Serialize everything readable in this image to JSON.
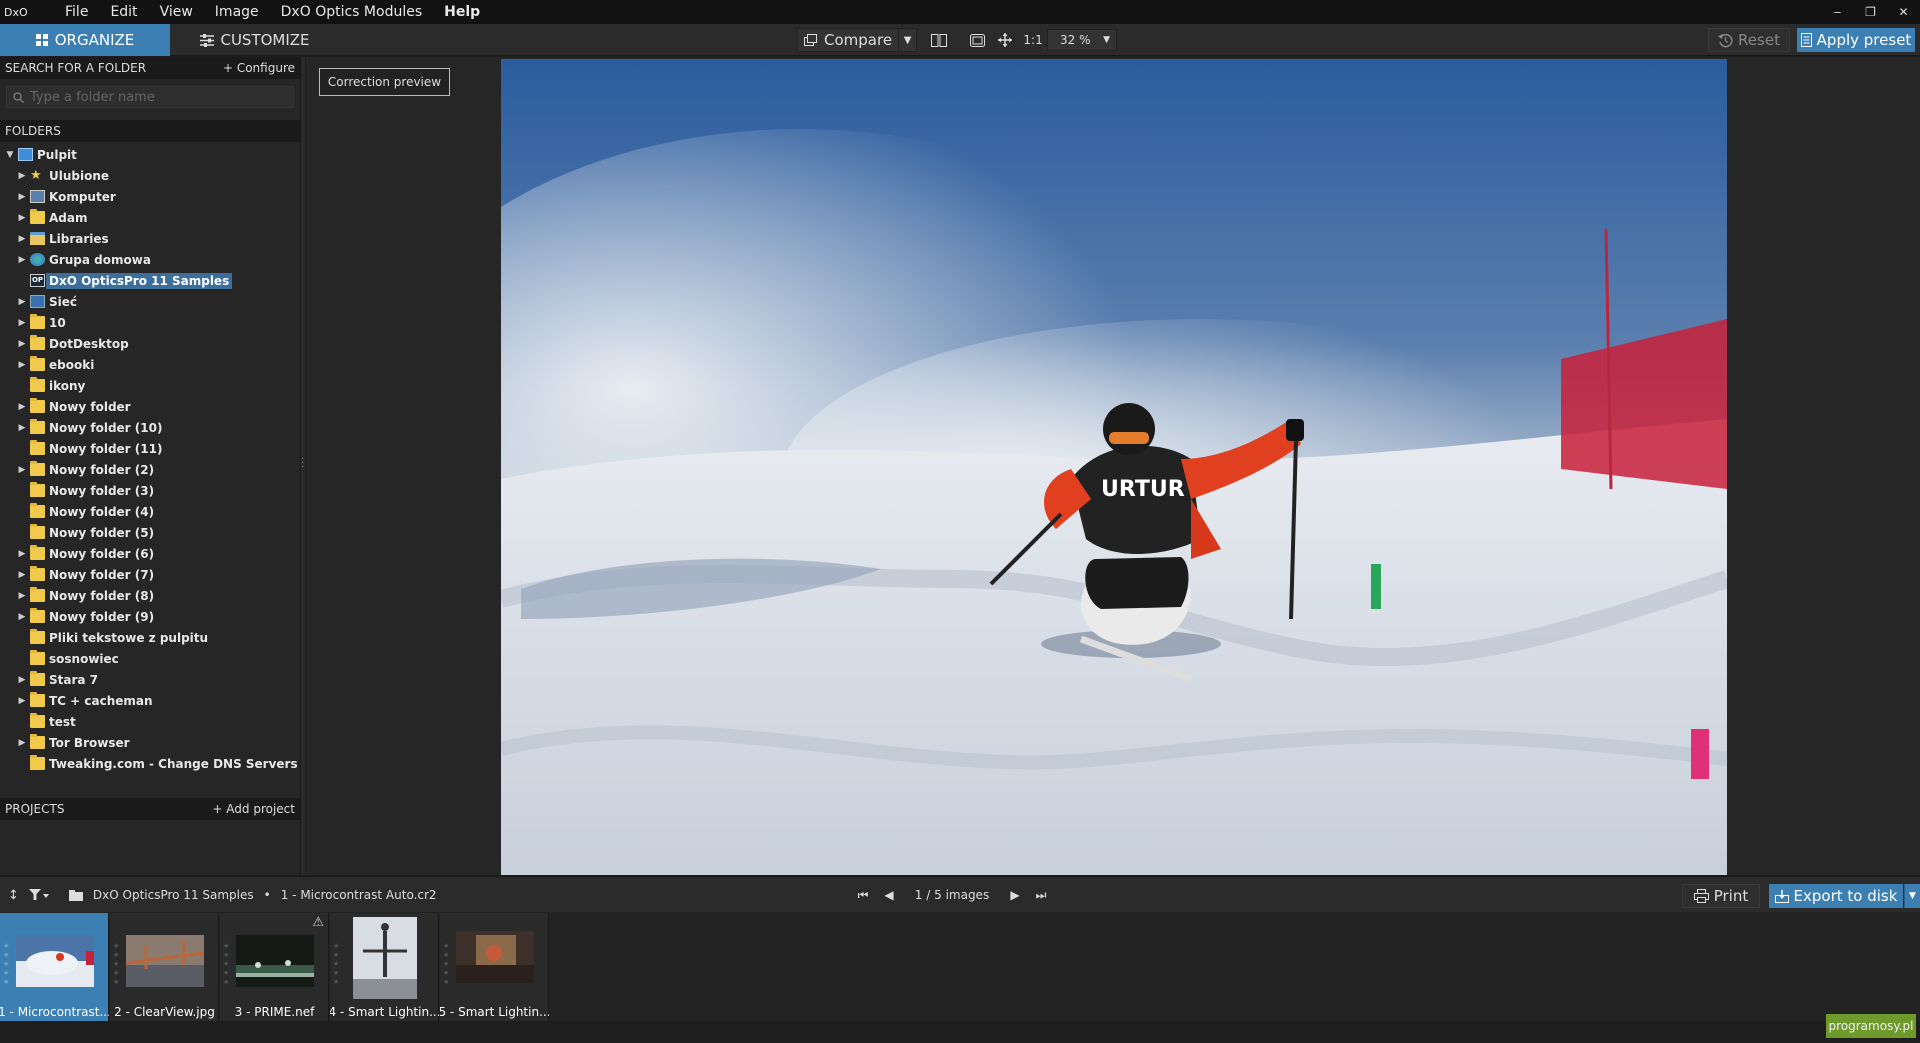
{
  "app": {
    "logo_text": "DxO",
    "menu": [
      "File",
      "Edit",
      "View",
      "Image",
      "DxO Optics Modules",
      "Help"
    ]
  },
  "window_controls": {
    "minimize": "‒",
    "restore": "❐",
    "close": "✕"
  },
  "toolbar": {
    "tab_organize": "ORGANIZE",
    "tab_customize": "CUSTOMIZE",
    "compare_label": "Compare",
    "one_to_one": "1:1",
    "zoom_value": "32 %",
    "reset_label": "Reset",
    "apply_preset_label": "Apply preset"
  },
  "search_section": {
    "header": "SEARCH FOR A FOLDER",
    "configure": "+ Configure",
    "placeholder": "Type a folder name"
  },
  "folders_section": {
    "header": "FOLDERS",
    "items": [
      {
        "label": "Pulpit",
        "level": 0,
        "expanded": true,
        "icon": "desktop-icon"
      },
      {
        "label": "Ulubione",
        "level": 1,
        "arrow": true,
        "icon": "star-icon"
      },
      {
        "label": "Komputer",
        "level": 1,
        "arrow": true,
        "icon": "computer-icon"
      },
      {
        "label": "Adam",
        "level": 1,
        "arrow": true,
        "icon": "folder-icon"
      },
      {
        "label": "Libraries",
        "level": 1,
        "arrow": true,
        "icon": "libraries-icon"
      },
      {
        "label": "Grupa domowa",
        "level": 1,
        "arrow": true,
        "icon": "homegroup-icon"
      },
      {
        "label": "DxO OpticsPro 11 Samples",
        "level": 1,
        "arrow": false,
        "icon": "dxo-icon",
        "selected": true
      },
      {
        "label": "Sieć",
        "level": 1,
        "arrow": true,
        "icon": "network-icon"
      },
      {
        "label": "10",
        "level": 1,
        "arrow": true,
        "icon": "folder-icon"
      },
      {
        "label": "DotDesktop",
        "level": 1,
        "arrow": true,
        "icon": "folder-icon"
      },
      {
        "label": "ebooki",
        "level": 1,
        "arrow": true,
        "icon": "folder-icon"
      },
      {
        "label": "ikony",
        "level": 1,
        "arrow": false,
        "icon": "folder-icon"
      },
      {
        "label": "Nowy folder",
        "level": 1,
        "arrow": true,
        "icon": "folder-icon"
      },
      {
        "label": "Nowy folder (10)",
        "level": 1,
        "arrow": true,
        "icon": "folder-icon"
      },
      {
        "label": "Nowy folder (11)",
        "level": 1,
        "arrow": false,
        "icon": "folder-icon"
      },
      {
        "label": "Nowy folder (2)",
        "level": 1,
        "arrow": true,
        "icon": "folder-icon"
      },
      {
        "label": "Nowy folder (3)",
        "level": 1,
        "arrow": false,
        "icon": "folder-icon"
      },
      {
        "label": "Nowy folder (4)",
        "level": 1,
        "arrow": false,
        "icon": "folder-icon"
      },
      {
        "label": "Nowy folder (5)",
        "level": 1,
        "arrow": false,
        "icon": "folder-icon"
      },
      {
        "label": "Nowy folder (6)",
        "level": 1,
        "arrow": true,
        "icon": "folder-icon"
      },
      {
        "label": "Nowy folder (7)",
        "level": 1,
        "arrow": true,
        "icon": "folder-icon"
      },
      {
        "label": "Nowy folder (8)",
        "level": 1,
        "arrow": true,
        "icon": "folder-icon"
      },
      {
        "label": "Nowy folder (9)",
        "level": 1,
        "arrow": true,
        "icon": "folder-icon"
      },
      {
        "label": "Pliki tekstowe z pulpitu",
        "level": 1,
        "arrow": false,
        "icon": "folder-icon"
      },
      {
        "label": "sosnowiec",
        "level": 1,
        "arrow": false,
        "icon": "folder-icon"
      },
      {
        "label": "Stara 7",
        "level": 1,
        "arrow": true,
        "icon": "folder-icon"
      },
      {
        "label": "TC + cacheman",
        "level": 1,
        "arrow": true,
        "icon": "folder-icon"
      },
      {
        "label": "test",
        "level": 1,
        "arrow": false,
        "icon": "folder-icon"
      },
      {
        "label": "Tor Browser",
        "level": 1,
        "arrow": true,
        "icon": "folder-icon"
      },
      {
        "label": "Tweaking.com - Change DNS Servers",
        "level": 1,
        "arrow": false,
        "icon": "folder-icon"
      }
    ]
  },
  "projects_section": {
    "header": "PROJECTS",
    "add": "+ Add project"
  },
  "viewer": {
    "correction_preview": "Correction preview"
  },
  "filmbar": {
    "sort_glyph": "↕",
    "path_folder": "DxO OpticsPro 11 Samples",
    "path_sep": "•",
    "path_file": "1 - Microcontrast Auto.cr2",
    "counter": "1 / 5",
    "counter_unit": "images",
    "print_label": "Print",
    "export_label": "Export to disk"
  },
  "thumbnails": [
    {
      "caption": "1 - Microcontrast...",
      "selected": true
    },
    {
      "caption": "2 - ClearView.jpg",
      "selected": false
    },
    {
      "caption": "3 - PRIME.nef",
      "selected": false
    },
    {
      "caption": "4 - Smart Lightin...",
      "selected": false
    },
    {
      "caption": "5 - Smart Lightin...",
      "selected": false
    }
  ],
  "watermark": "programosy.pl",
  "colors": {
    "accent": "#3c7fb2",
    "panel": "#262626",
    "menubar": "#121212"
  }
}
